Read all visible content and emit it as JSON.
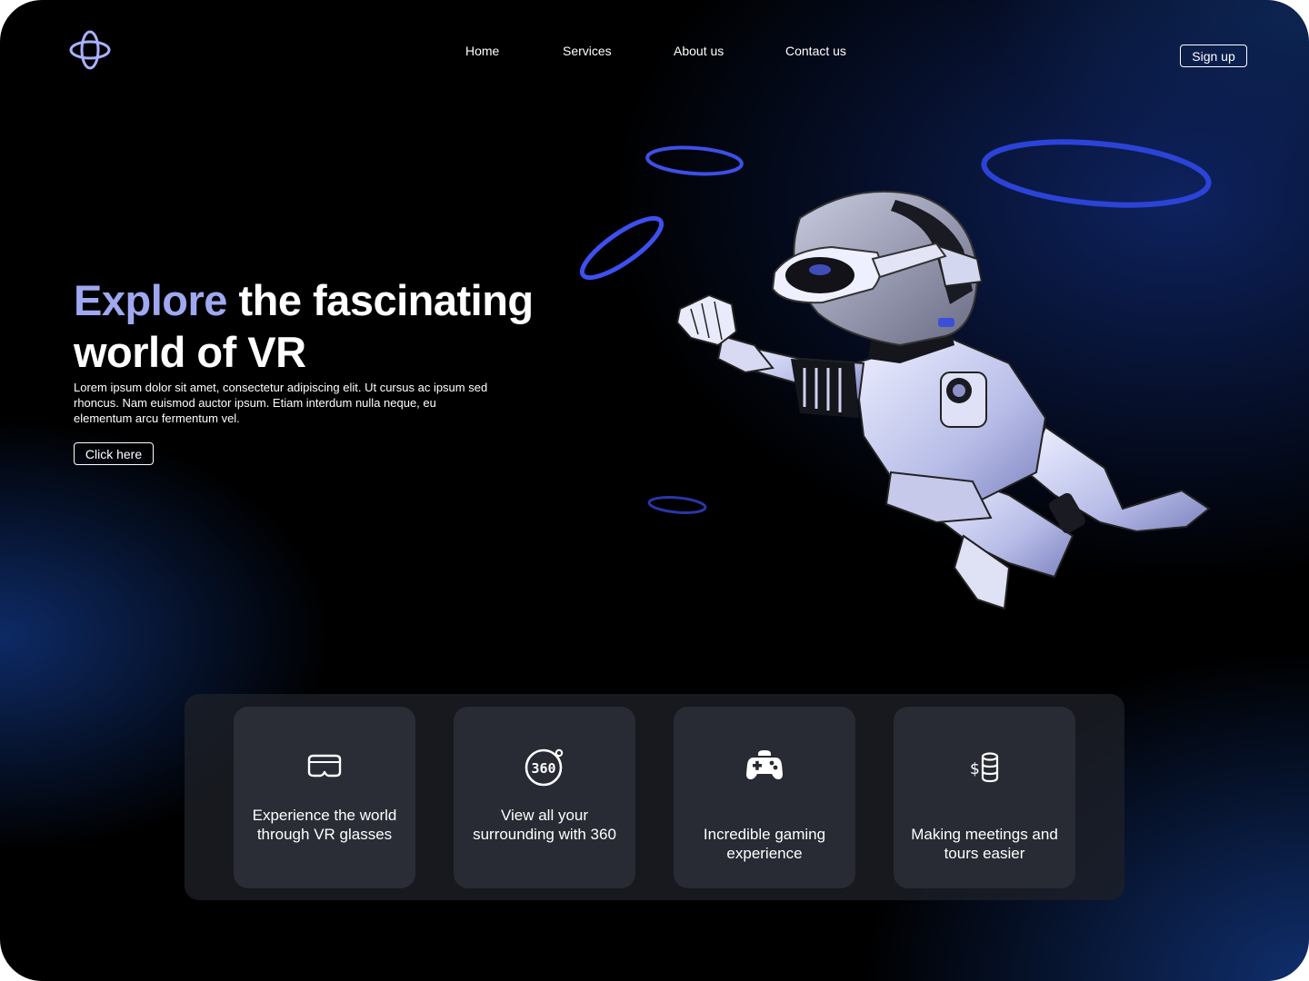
{
  "header": {
    "logo_icon": "orbit-logo-icon",
    "nav": [
      {
        "label": "Home"
      },
      {
        "label": "Services"
      },
      {
        "label": "About us"
      },
      {
        "label": "Contact us"
      }
    ],
    "signup_label": "Sign up"
  },
  "hero": {
    "title_accent": "Explore",
    "title_rest": " the fascinating world of VR",
    "body": "Lorem ipsum dolor sit amet, consectetur adipiscing elit. Ut cursus ac ipsum sed rhoncus. Nam euismod auctor ipsum. Etiam interdum nulla neque, eu elementum arcu fermentum vel.",
    "cta_label": "Click here"
  },
  "features": [
    {
      "icon": "vr-headset-icon",
      "label": "Experience the world through VR glasses"
    },
    {
      "icon": "360-view-icon",
      "label": "View all your surrounding with 360"
    },
    {
      "icon": "gamepad-icon",
      "label": "Incredible gaming experience"
    },
    {
      "icon": "dollar-coins-icon",
      "label": "Making meetings and tours easier"
    }
  ],
  "colors": {
    "accent": "#9fa8f0",
    "background": "#000000",
    "ring": "#3a4fe0",
    "card": "#282b33"
  }
}
